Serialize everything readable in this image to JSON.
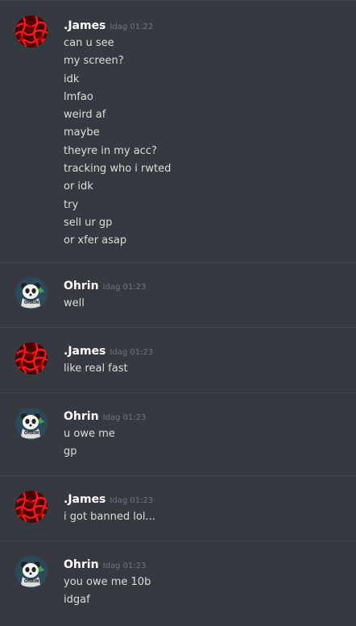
{
  "colors": {
    "background": "#36393f",
    "divider": "#40444b",
    "username": "#ffffff",
    "message_text": "#dcddde",
    "timestamp": "#72767d"
  },
  "messages": [
    {
      "author": ".James",
      "timestamp": "Idag 01:22",
      "avatar_icon": "red-cell-pattern-avatar",
      "lines": [
        "can u see",
        "my screen?",
        "idk",
        "lmfao",
        "weird af",
        "maybe",
        "theyre in my acc?",
        "tracking who i rwted",
        "or idk",
        "try",
        "sell ur gp",
        "or xfer asap"
      ]
    },
    {
      "author": "Ohrin",
      "timestamp": "Idag 01:23",
      "avatar_icon": "panda-avatar",
      "avatar_caption": "OHRIN",
      "lines": [
        "well"
      ]
    },
    {
      "author": ".James",
      "timestamp": "Idag 01:23",
      "avatar_icon": "red-cell-pattern-avatar",
      "lines": [
        "like real fast"
      ]
    },
    {
      "author": "Ohrin",
      "timestamp": "Idag 01:23",
      "avatar_icon": "panda-avatar",
      "avatar_caption": "OHRIN",
      "lines": [
        "u owe me",
        "gp"
      ]
    },
    {
      "author": ".James",
      "timestamp": "Idag 01:23",
      "avatar_icon": "red-cell-pattern-avatar",
      "lines": [
        "i got banned lol..."
      ]
    },
    {
      "author": "Ohrin",
      "timestamp": "Idag 01:23",
      "avatar_icon": "panda-avatar",
      "avatar_caption": "OHRIN",
      "lines": [
        "you owe me 10b",
        "idgaf"
      ]
    }
  ]
}
